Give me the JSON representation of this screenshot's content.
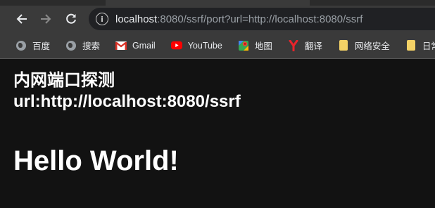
{
  "browser": {
    "url_host": "localhost",
    "url_rest": ":8080/ssrf/port?url=http://localhost:8080/ssrf",
    "icons": {
      "back": "back-arrow-icon",
      "forward": "forward-arrow-icon",
      "reload": "reload-icon",
      "info": "info-icon"
    }
  },
  "bookmarks": [
    {
      "label": "百度",
      "icon": "globe-icon"
    },
    {
      "label": "搜索",
      "icon": "globe-icon"
    },
    {
      "label": "Gmail",
      "icon": "gmail-icon"
    },
    {
      "label": "YouTube",
      "icon": "youtube-icon"
    },
    {
      "label": "地图",
      "icon": "maps-icon"
    },
    {
      "label": "翻译",
      "icon": "translate-icon"
    },
    {
      "label": "网络安全",
      "icon": "folder-icon"
    },
    {
      "label": "日常",
      "icon": "folder-icon"
    }
  ],
  "page": {
    "heading_line1": "内网端口探测",
    "heading_line2": "url:http://localhost:8080/ssrf",
    "hello": "Hello World!"
  },
  "colors": {
    "page_bg": "#121212",
    "toolbar_bg": "#3a3a3a",
    "omnibox_bg": "#202124",
    "text": "#ffffff"
  }
}
